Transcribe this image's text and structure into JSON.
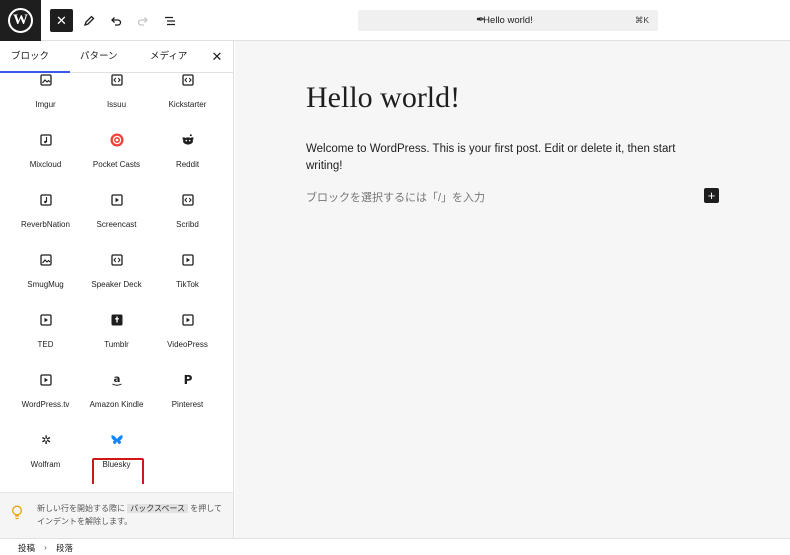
{
  "topbar": {
    "logo": "W",
    "close_icon": "✕",
    "doc_title": "Hello world!",
    "shortcut": "⌘K"
  },
  "inserter": {
    "tabs": [
      "ブロック",
      "パターン",
      "メディア"
    ],
    "active_tab": "ブロック",
    "close": "✕",
    "blocks": [
      {
        "label": "Imgur",
        "icon": "image-icon"
      },
      {
        "label": "Issuu",
        "icon": "embed-icon"
      },
      {
        "label": "Kickstarter",
        "icon": "embed-icon"
      },
      {
        "label": "Mixcloud",
        "icon": "audio-icon"
      },
      {
        "label": "Pocket Casts",
        "icon": "pocketcasts-icon"
      },
      {
        "label": "Reddit",
        "icon": "reddit-icon"
      },
      {
        "label": "ReverbNation",
        "icon": "audio-icon"
      },
      {
        "label": "Screencast",
        "icon": "video-icon"
      },
      {
        "label": "Scribd",
        "icon": "embed-icon"
      },
      {
        "label": "SmugMug",
        "icon": "image-icon"
      },
      {
        "label": "Speaker Deck",
        "icon": "embed-icon"
      },
      {
        "label": "TikTok",
        "icon": "video-icon"
      },
      {
        "label": "TED",
        "icon": "video-icon"
      },
      {
        "label": "Tumblr",
        "icon": "tumblr-icon"
      },
      {
        "label": "VideoPress",
        "icon": "video-icon"
      },
      {
        "label": "WordPress.tv",
        "icon": "video-icon"
      },
      {
        "label": "Amazon Kindle",
        "icon": "amazon-icon"
      },
      {
        "label": "Pinterest",
        "icon": "pinterest-icon"
      },
      {
        "label": "Wolfram",
        "icon": "wolfram-icon"
      },
      {
        "label": "Bluesky",
        "icon": "bluesky-icon"
      }
    ],
    "selected_block": "Bluesky",
    "tip": {
      "before": "新しい行を開始する際に",
      "key": "バックスペース",
      "after": "を押してインデントを解除します。"
    }
  },
  "editor": {
    "title": "Hello world!",
    "body": "Welcome to WordPress. This is your first post. Edit or delete it, then start writing!",
    "placeholder": "ブロックを選択するには「/」を入力",
    "inserter_button": "+"
  },
  "breadcrumb": [
    "投稿",
    "段落"
  ],
  "colors": {
    "accent": "#3858e9",
    "selection": "#cc1818",
    "bluesky": "#1185fe",
    "pocketcasts": "#f43e37",
    "dark": "#1e1e1e"
  }
}
